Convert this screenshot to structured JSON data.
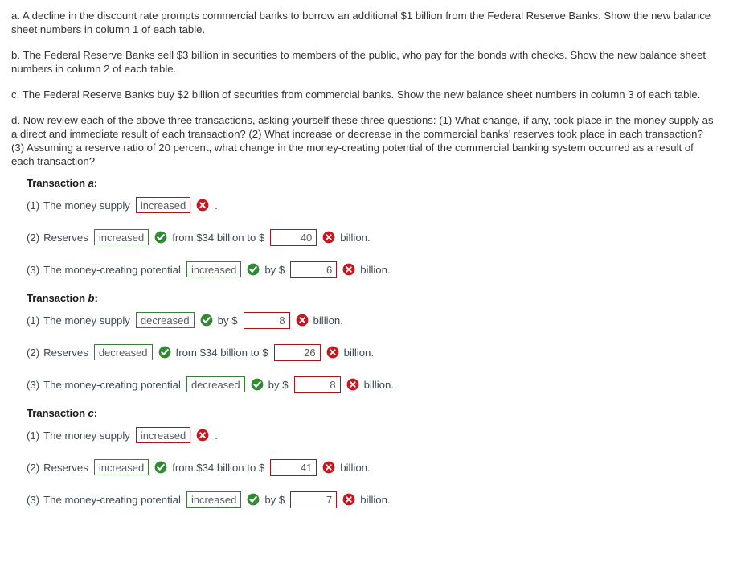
{
  "prompts": [
    "a. A decline in the discount rate prompts commercial banks to borrow an additional $1 billion from the Federal Reserve Banks. Show the new balance sheet numbers in column 1 of each table.",
    "b. The Federal Reserve Banks sell $3 billion in securities to members of the public, who pay for the bonds with checks. Show the new balance sheet numbers in column 2 of each table.",
    "c. The Federal Reserve Banks buy $2 billion of securities from commercial banks. Show the new balance sheet numbers in column 3 of each table.",
    "d. Now review each of the above three transactions, asking yourself these three questions: (1) What change, if any, took place in the money supply as a direct and immediate result of each transaction? (2) What increase or decrease in the commercial banks’ reserves took place in each transaction? (3) Assuming a reserve ratio of 20 percent, what change in the money-creating potential of the commercial banking system occurred as a result of each transaction?"
  ],
  "colors": {
    "correct_green": "#3b7a3b",
    "incorrect_red": "#a4191c",
    "icon_green": "#2f8a32",
    "icon_red": "#c9161e",
    "body_text": "#333333",
    "answer_text": "#3c4a52"
  },
  "transactions": [
    {
      "heading_word": "Transaction",
      "letter": "a",
      "colon": ":",
      "rows": [
        {
          "number": "(1)",
          "lead": "The money supply",
          "select_value": "increased",
          "select_state": "incorrect",
          "select_icon": "x-circle-icon",
          "mid": "",
          "has_number": false,
          "number_value": "",
          "number_state": "",
          "number_icon": "",
          "tail": ".",
          "tail_is_period": true
        },
        {
          "number": "(2)",
          "lead": "Reserves",
          "select_value": "increased",
          "select_state": "correct",
          "select_icon": "check-circle-icon",
          "mid": "from $34 billion to $",
          "has_number": true,
          "number_value": "40",
          "number_state": "incorrect",
          "number_icon": "x-circle-icon",
          "tail": "billion.",
          "tail_is_period": false
        },
        {
          "number": "(3)",
          "lead": "The money-creating potential",
          "select_value": "increased",
          "select_state": "correct",
          "select_icon": "check-circle-icon",
          "mid": "by $",
          "has_number": true,
          "number_value": "6",
          "number_state": "incorrect",
          "number_icon": "x-circle-icon",
          "tail": "billion.",
          "tail_is_period": false
        }
      ]
    },
    {
      "heading_word": "Transaction",
      "letter": "b",
      "colon": ":",
      "rows": [
        {
          "number": "(1)",
          "lead": "The money supply",
          "select_value": "decreased",
          "select_state": "correct",
          "select_icon": "check-circle-icon",
          "mid": "by $",
          "has_number": true,
          "number_value": "8",
          "number_state": "incorrect",
          "number_icon": "x-circle-icon",
          "tail": "billion.",
          "tail_is_period": false
        },
        {
          "number": "(2)",
          "lead": "Reserves",
          "select_value": "decreased",
          "select_state": "correct",
          "select_icon": "check-circle-icon",
          "mid": "from $34 billion to $",
          "has_number": true,
          "number_value": "26",
          "number_state": "incorrect",
          "number_icon": "x-circle-icon",
          "tail": "billion.",
          "tail_is_period": false
        },
        {
          "number": "(3)",
          "lead": "The money-creating potential",
          "select_value": "decreased",
          "select_state": "correct",
          "select_icon": "check-circle-icon",
          "mid": "by $",
          "has_number": true,
          "number_value": "8",
          "number_state": "incorrect",
          "number_icon": "x-circle-icon",
          "tail": "billion.",
          "tail_is_period": false
        }
      ]
    },
    {
      "heading_word": "Transaction",
      "letter": "c",
      "colon": ":",
      "rows": [
        {
          "number": "(1)",
          "lead": "The money supply",
          "select_value": "increased",
          "select_state": "incorrect",
          "select_icon": "x-circle-icon",
          "mid": "",
          "has_number": false,
          "number_value": "",
          "number_state": "",
          "number_icon": "",
          "tail": ".",
          "tail_is_period": true
        },
        {
          "number": "(2)",
          "lead": "Reserves",
          "select_value": "increased",
          "select_state": "correct",
          "select_icon": "check-circle-icon",
          "mid": "from $34 billion to $",
          "has_number": true,
          "number_value": "41",
          "number_state": "incorrect",
          "number_icon": "x-circle-icon",
          "tail": "billion.",
          "tail_is_period": false
        },
        {
          "number": "(3)",
          "lead": "The money-creating potential",
          "select_value": "increased",
          "select_state": "correct",
          "select_icon": "check-circle-icon",
          "mid": "by $",
          "has_number": true,
          "number_value": "7",
          "number_state": "incorrect",
          "number_icon": "x-circle-icon",
          "tail": "billion.",
          "tail_is_period": false
        }
      ]
    }
  ]
}
